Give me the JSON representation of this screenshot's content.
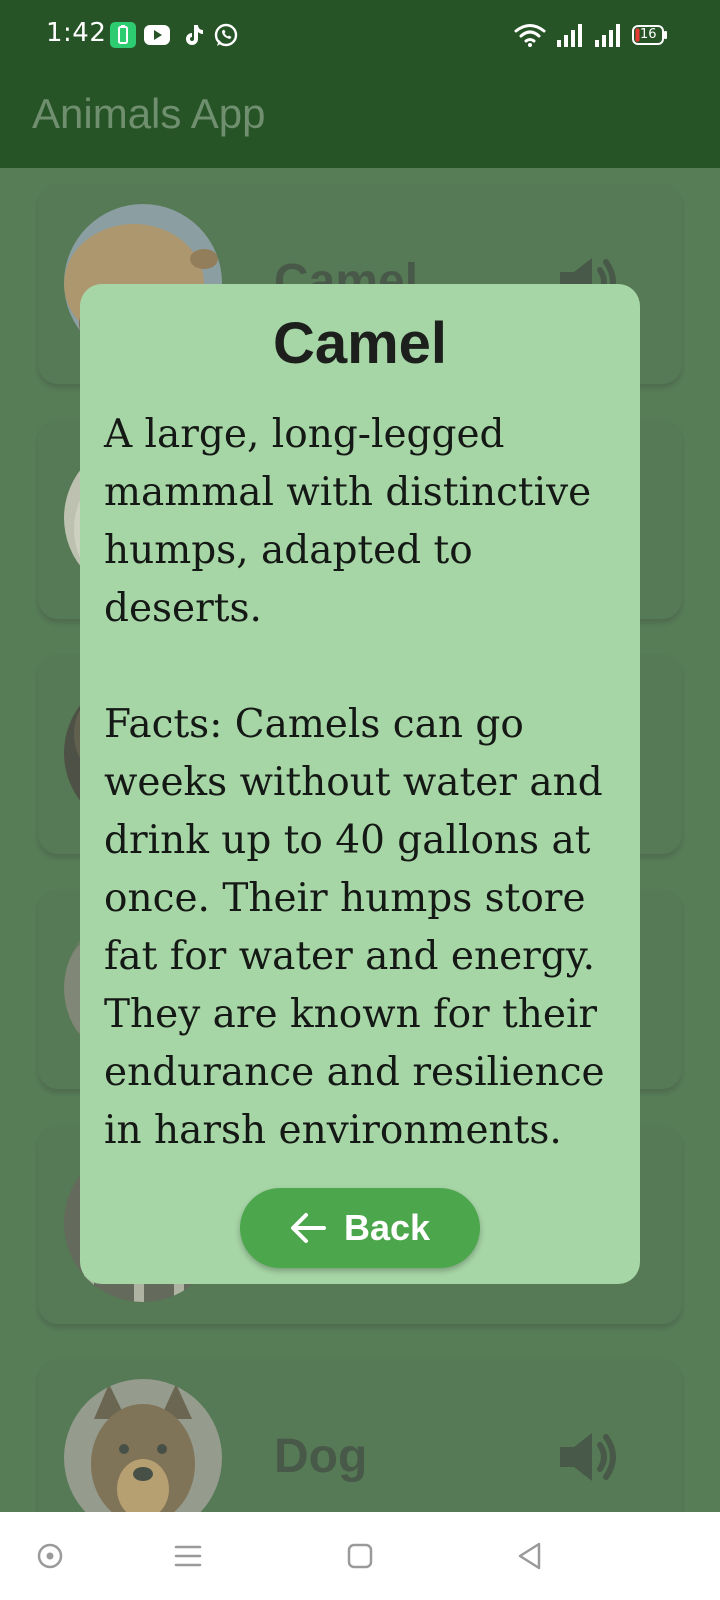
{
  "status_bar": {
    "time": "1:42",
    "battery": "16",
    "notification_icons": [
      "battery-saver-icon",
      "youtube-icon",
      "tiktok-icon",
      "whatsapp-icon"
    ],
    "system_icons": [
      "wifi-icon",
      "signal-icon",
      "signal-icon",
      "battery-icon"
    ]
  },
  "app_bar": {
    "title": "Animals App"
  },
  "colors": {
    "app_bar": "#275427",
    "card": "#275427",
    "dialog": "#a6d5a6",
    "button": "#4ca74c",
    "navigation_bar": "#ffffff"
  },
  "list": {
    "items": [
      {
        "name": "Camel",
        "image": "camel-photo",
        "sound_icon": "speaker-icon"
      },
      {
        "name": "",
        "image": "animal-photo",
        "sound_icon": "speaker-icon"
      },
      {
        "name": "",
        "image": "animal-photo",
        "sound_icon": "speaker-icon"
      },
      {
        "name": "",
        "image": "animal-photo",
        "sound_icon": "speaker-icon"
      },
      {
        "name": "",
        "image": "animal-photo",
        "sound_icon": "speaker-icon"
      },
      {
        "name": "Dog",
        "image": "dog-photo",
        "sound_icon": "speaker-icon"
      }
    ]
  },
  "dialog": {
    "title": "Camel",
    "description": "A large, long-legged mammal with distinctive humps, adapted to deserts.",
    "facts": "Facts: Camels can go weeks without water and drink up to 40 gallons at once. Their humps store fat for water and energy. They are known for their endurance and resilience in harsh environments.",
    "back_button": {
      "label": "Back",
      "icon": "arrow-left-icon"
    }
  },
  "navigation_bar": {
    "buttons": [
      "assistant-icon",
      "menu-icon",
      "home-icon",
      "back-icon"
    ]
  }
}
